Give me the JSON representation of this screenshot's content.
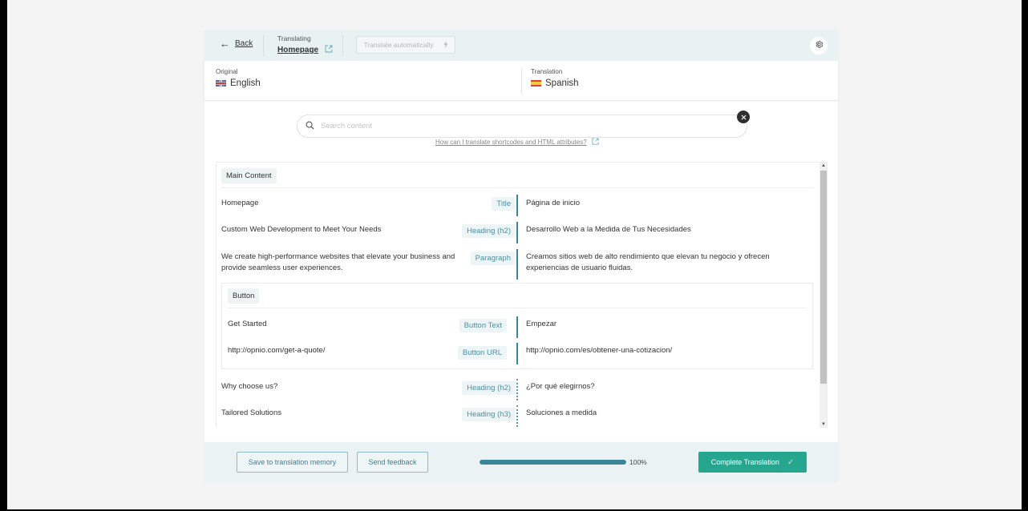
{
  "header": {
    "back_label": "Back",
    "translating_label": "Translating",
    "page_name": "Homepage",
    "translate_auto_label": "Translate automatically"
  },
  "languages": {
    "original_label": "Original",
    "original_name": "English",
    "translation_label": "Translation",
    "translation_name": "Spanish"
  },
  "search": {
    "placeholder": "Search content",
    "value": "",
    "help_link": "How can I translate shortcodes and HTML attributes?"
  },
  "content": {
    "section_main": "Main Content",
    "rows": [
      {
        "source": "Homepage",
        "type": "Title",
        "target": "Página de inicio",
        "status": "translated"
      },
      {
        "source": "Custom Web Development to Meet Your Needs",
        "type": "Heading (h2)",
        "target": "Desarrollo Web a la Medida de Tus Necesidades",
        "status": "translated"
      },
      {
        "source": "We create high-performance websites that elevate your business and provide seamless user experiences.",
        "type": "Paragraph",
        "target": "Creamos sitios web de alto rendimiento que elevan tu negocio y ofrecen experiencias de usuario fluidas.",
        "status": "translated"
      }
    ],
    "section_button": "Button",
    "button_rows": [
      {
        "source": "Get Started",
        "type": "Button Text",
        "target": "Empezar",
        "status": "translated"
      },
      {
        "source": "http://opnio.com/get-a-quote/",
        "type": "Button URL",
        "target": "http://opnio.com/es/obtener-una-cotizacion/",
        "status": "translated"
      }
    ],
    "rows_after": [
      {
        "source": "Why choose us?",
        "type": "Heading (h2)",
        "target": "¿Por qué elegirnos?",
        "status": "auto"
      },
      {
        "source": "Tailored Solutions",
        "type": "Heading (h3)",
        "target": "Soluciones a medida",
        "status": "auto"
      }
    ]
  },
  "footer": {
    "save_memory_label": "Save to translation memory",
    "feedback_label": "Send feedback",
    "progress_percent": 100,
    "progress_label": "100%",
    "complete_label": "Complete Translation"
  },
  "colors": {
    "accent": "#3a8699",
    "complete_button": "#26a68f",
    "header_bg": "#e8f2f3"
  }
}
